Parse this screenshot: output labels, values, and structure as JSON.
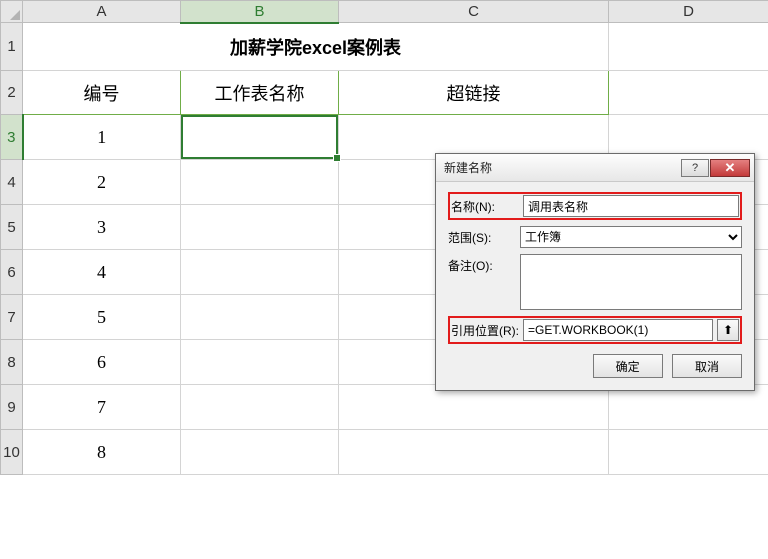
{
  "columns": [
    "A",
    "B",
    "C",
    "D"
  ],
  "rows": [
    "1",
    "2",
    "3",
    "4",
    "5",
    "6",
    "7",
    "8",
    "9",
    "10"
  ],
  "title": "加薪学院excel案例表",
  "headers": {
    "col1": "编号",
    "col2": "工作表名称",
    "col3": "超链接"
  },
  "numbers": [
    "1",
    "2",
    "3",
    "4",
    "5",
    "6",
    "7",
    "8"
  ],
  "selected_col": "B",
  "selected_row": "3",
  "dialog": {
    "title": "新建名称",
    "label_name": "名称(N):",
    "name_value": "调用表名称",
    "label_scope": "范围(S):",
    "scope_value": "工作簿",
    "label_comment": "备注(O):",
    "comment_value": "",
    "label_refers": "引用位置(R):",
    "refers_value": "=GET.WORKBOOK(1)",
    "ok": "确定",
    "cancel": "取消",
    "help": "?",
    "close": "✕",
    "ref_icon": "⬆"
  }
}
